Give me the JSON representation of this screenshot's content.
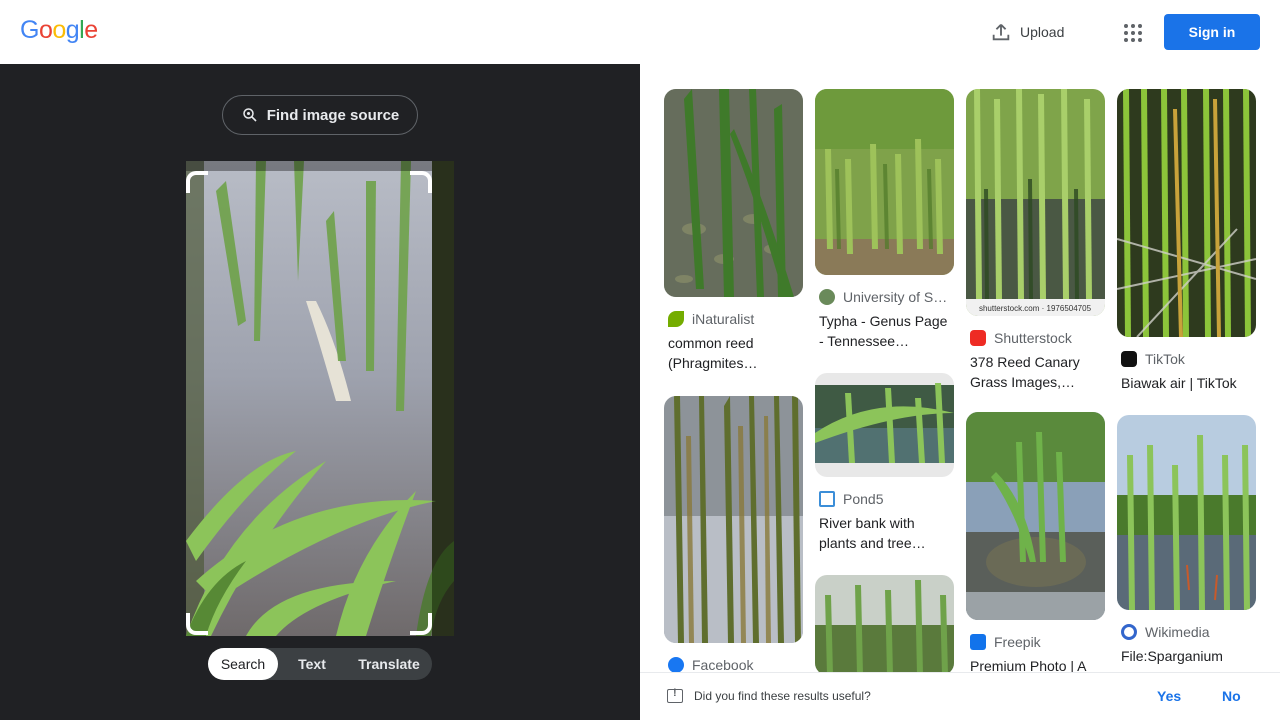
{
  "header": {
    "logo_letters": [
      {
        "ch": "G",
        "color": "#4285F4"
      },
      {
        "ch": "o",
        "color": "#EA4335"
      },
      {
        "ch": "o",
        "color": "#FBBC05"
      },
      {
        "ch": "g",
        "color": "#4285F4"
      },
      {
        "ch": "l",
        "color": "#34A853"
      },
      {
        "ch": "e",
        "color": "#EA4335"
      }
    ],
    "upload_label": "Upload",
    "signin_label": "Sign in"
  },
  "query": {
    "find_source_label": "Find image source",
    "modes": [
      "Search",
      "Text",
      "Translate"
    ],
    "active_mode": "Search"
  },
  "results": [
    {
      "source": "iNaturalist",
      "title": "common reed (Phragmites…",
      "favicon_color": "#74ac00",
      "watermark": ""
    },
    {
      "source": "Facebook",
      "title": "",
      "favicon_color": "#1877f2",
      "watermark": ""
    },
    {
      "source": "University of S…",
      "title": "Typha - Genus Page - Tennessee…",
      "favicon_color": "#6a8a5a",
      "watermark": ""
    },
    {
      "source": "Pond5",
      "title": "River bank with plants and tree…",
      "favicon_color": "#3b8ed8",
      "watermark": ""
    },
    {
      "source": "",
      "title": "",
      "favicon_color": "",
      "watermark": ""
    },
    {
      "source": "Shutterstock",
      "title": "378 Reed Canary Grass Images,…",
      "favicon_color": "#ee2b24",
      "watermark": "shutterstock.com · 1976504705"
    },
    {
      "source": "Freepik",
      "title": "Premium Photo | A",
      "favicon_color": "#1273eb",
      "watermark": ""
    },
    {
      "source": "TikTok",
      "title": "Biawak air | TikTok",
      "favicon_color": "#111111",
      "watermark": ""
    },
    {
      "source": "Wikimedia",
      "title": "File:Sparganium",
      "favicon_color": "#3366cc",
      "watermark": ""
    }
  ],
  "feedback": {
    "question": "Did you find these results useful?",
    "yes": "Yes",
    "no": "No"
  }
}
